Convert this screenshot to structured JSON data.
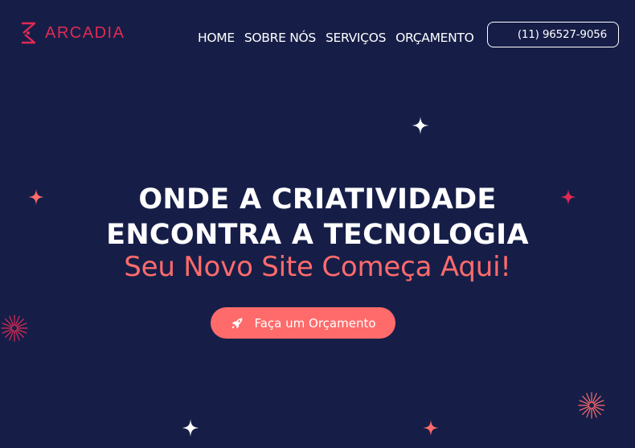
{
  "brand": {
    "name": "ARCADIA",
    "accent_color": "#e02a52"
  },
  "nav": {
    "items": [
      {
        "label": "HOME"
      },
      {
        "label": "SOBRE NÓS"
      },
      {
        "label": "SERVIÇOS"
      },
      {
        "label": "ORÇAMENTO"
      }
    ]
  },
  "contact": {
    "phone": "(11) 96527-9056"
  },
  "hero": {
    "title_line1": "ONDE A CRIATIVIDADE",
    "title_line2": "ENCONTRA A TECNOLOGIA",
    "subtitle": "Seu Novo Site Começa Aqui!",
    "cta_label": "Faça um Orçamento",
    "cta_icon": "rocket-icon"
  },
  "colors": {
    "background": "#161e48",
    "coral": "#ff6b6b",
    "text": "#ffffff"
  }
}
